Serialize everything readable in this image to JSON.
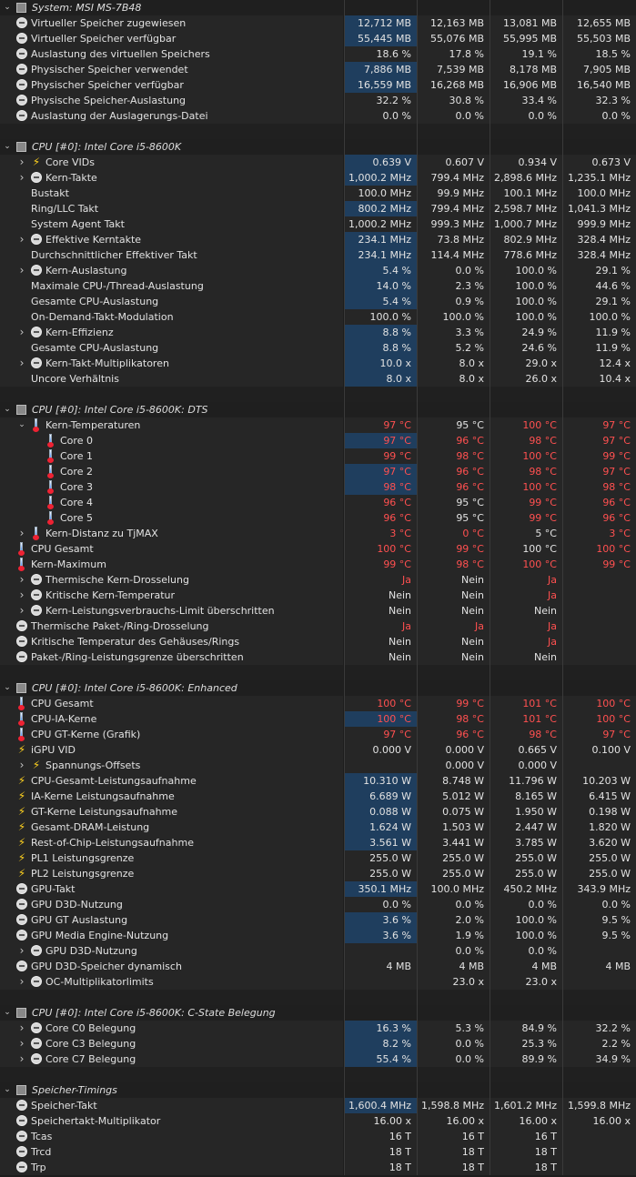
{
  "sections": [
    {
      "title": "System: MSI MS-7B48",
      "rows": [
        {
          "label": "Virtueller Speicher zugewiesen",
          "icon": "sensor",
          "vals": [
            "12,712 MB",
            "12,163 MB",
            "13,081 MB",
            "12,655 MB"
          ],
          "hl": true
        },
        {
          "label": "Virtueller Speicher verfügbar",
          "icon": "sensor",
          "vals": [
            "55,445 MB",
            "55,076 MB",
            "55,995 MB",
            "55,503 MB"
          ],
          "hl": true
        },
        {
          "label": "Auslastung des virtuellen Speichers",
          "icon": "sensor",
          "vals": [
            "18.6 %",
            "17.8 %",
            "19.1 %",
            "18.5 %"
          ]
        },
        {
          "label": "Physischer Speicher verwendet",
          "icon": "sensor",
          "vals": [
            "7,886 MB",
            "7,539 MB",
            "8,178 MB",
            "7,905 MB"
          ],
          "hl": true
        },
        {
          "label": "Physischer Speicher verfügbar",
          "icon": "sensor",
          "vals": [
            "16,559 MB",
            "16,268 MB",
            "16,906 MB",
            "16,540 MB"
          ],
          "hl": true
        },
        {
          "label": "Physische Speicher-Auslastung",
          "icon": "sensor",
          "vals": [
            "32.2 %",
            "30.8 %",
            "33.4 %",
            "32.3 %"
          ]
        },
        {
          "label": "Auslastung der Auslagerungs-Datei",
          "icon": "sensor",
          "vals": [
            "0.0 %",
            "0.0 %",
            "0.0 %",
            "0.0 %"
          ]
        }
      ]
    },
    {
      "title": "CPU [#0]: Intel Core i5-8600K",
      "rows": [
        {
          "label": "Core VIDs",
          "icon": "bolt",
          "expander": true,
          "vals": [
            "0.639 V",
            "0.607 V",
            "0.934 V",
            "0.673 V"
          ],
          "hl": true
        },
        {
          "label": "Kern-Takte",
          "icon": "sensor",
          "expander": true,
          "vals": [
            "1,000.2 MHz",
            "799.4 MHz",
            "2,898.6 MHz",
            "1,235.1 MHz"
          ],
          "hl": true
        },
        {
          "label": "Bustakt",
          "icon": "",
          "vals": [
            "100.0 MHz",
            "99.9 MHz",
            "100.1 MHz",
            "100.0 MHz"
          ]
        },
        {
          "label": "Ring/LLC Takt",
          "icon": "",
          "vals": [
            "800.2 MHz",
            "799.4 MHz",
            "2,598.7 MHz",
            "1,041.3 MHz"
          ],
          "hl": true
        },
        {
          "label": "System Agent Takt",
          "icon": "",
          "vals": [
            "1,000.2 MHz",
            "999.3 MHz",
            "1,000.7 MHz",
            "999.9 MHz"
          ]
        },
        {
          "label": "Effektive Kerntakte",
          "icon": "sensor",
          "expander": true,
          "vals": [
            "234.1 MHz",
            "73.8 MHz",
            "802.9 MHz",
            "328.4 MHz"
          ],
          "hl": true
        },
        {
          "label": "Durchschnittlicher Effektiver Takt",
          "icon": "",
          "vals": [
            "234.1 MHz",
            "114.4 MHz",
            "778.6 MHz",
            "328.4 MHz"
          ],
          "hl": true
        },
        {
          "label": "Kern-Auslastung",
          "icon": "sensor",
          "expander": true,
          "vals": [
            "5.4 %",
            "0.0 %",
            "100.0 %",
            "29.1 %"
          ],
          "hl": true
        },
        {
          "label": "Maximale CPU-/Thread-Auslastung",
          "icon": "",
          "vals": [
            "14.0 %",
            "2.3 %",
            "100.0 %",
            "44.6 %"
          ],
          "hl": true
        },
        {
          "label": "Gesamte CPU-Auslastung",
          "icon": "",
          "vals": [
            "5.4 %",
            "0.9 %",
            "100.0 %",
            "29.1 %"
          ],
          "hl": true
        },
        {
          "label": "On-Demand-Takt-Modulation",
          "icon": "",
          "vals": [
            "100.0 %",
            "100.0 %",
            "100.0 %",
            "100.0 %"
          ]
        },
        {
          "label": "Kern-Effizienz",
          "icon": "sensor",
          "expander": true,
          "vals": [
            "8.8 %",
            "3.3 %",
            "24.9 %",
            "11.9 %"
          ],
          "hl": true
        },
        {
          "label": "Gesamte CPU-Auslastung",
          "icon": "",
          "vals": [
            "8.8 %",
            "5.2 %",
            "24.6 %",
            "11.9 %"
          ],
          "hl": true
        },
        {
          "label": "Kern-Takt-Multiplikatoren",
          "icon": "sensor",
          "expander": true,
          "vals": [
            "10.0 x",
            "8.0 x",
            "29.0 x",
            "12.4 x"
          ],
          "hl": true
        },
        {
          "label": "Uncore Verhältnis",
          "icon": "",
          "vals": [
            "8.0 x",
            "8.0 x",
            "26.0 x",
            "10.4 x"
          ],
          "hl": true
        }
      ]
    },
    {
      "title": "CPU [#0]: Intel Core i5-8600K: DTS",
      "rows": [
        {
          "label": "Kern-Temperaturen",
          "icon": "thermo",
          "expander": true,
          "open": true,
          "vals": [
            "97 °C",
            "95 °C",
            "100 °C",
            "97 °C"
          ],
          "hot": [
            1,
            0,
            1,
            1
          ]
        },
        {
          "label": "Core 0",
          "icon": "thermo",
          "indent": 2,
          "vals": [
            "97 °C",
            "96 °C",
            "98 °C",
            "97 °C"
          ],
          "hot": [
            1,
            1,
            1,
            1
          ],
          "hl": true
        },
        {
          "label": "Core 1",
          "icon": "thermo",
          "indent": 2,
          "vals": [
            "99 °C",
            "98 °C",
            "100 °C",
            "99 °C"
          ],
          "hot": [
            1,
            1,
            1,
            1
          ]
        },
        {
          "label": "Core 2",
          "icon": "thermo",
          "indent": 2,
          "vals": [
            "97 °C",
            "96 °C",
            "98 °C",
            "97 °C"
          ],
          "hot": [
            1,
            1,
            1,
            1
          ],
          "hl": true
        },
        {
          "label": "Core 3",
          "icon": "thermo",
          "indent": 2,
          "vals": [
            "98 °C",
            "96 °C",
            "100 °C",
            "98 °C"
          ],
          "hot": [
            1,
            1,
            1,
            1
          ],
          "hl": true
        },
        {
          "label": "Core 4",
          "icon": "thermo",
          "indent": 2,
          "vals": [
            "96 °C",
            "95 °C",
            "99 °C",
            "96 °C"
          ],
          "hot": [
            1,
            0,
            1,
            1
          ]
        },
        {
          "label": "Core 5",
          "icon": "thermo",
          "indent": 2,
          "vals": [
            "96 °C",
            "95 °C",
            "99 °C",
            "96 °C"
          ],
          "hot": [
            1,
            0,
            1,
            1
          ]
        },
        {
          "label": "Kern-Distanz zu TjMAX",
          "icon": "thermo",
          "expander": true,
          "vals": [
            "3 °C",
            "0 °C",
            "5 °C",
            "3 °C"
          ],
          "hot": [
            1,
            1,
            0,
            1
          ]
        },
        {
          "label": "CPU Gesamt",
          "icon": "thermo",
          "vals": [
            "100 °C",
            "99 °C",
            "100 °C",
            "100 °C"
          ],
          "hot": [
            1,
            1,
            0,
            1
          ]
        },
        {
          "label": "Kern-Maximum",
          "icon": "thermo",
          "vals": [
            "99 °C",
            "98 °C",
            "100 °C",
            "99 °C"
          ],
          "hot": [
            1,
            1,
            1,
            1
          ]
        },
        {
          "label": "Thermische Kern-Drosselung",
          "icon": "sensor",
          "expander": true,
          "vals": [
            "Ja",
            "Nein",
            "Ja",
            ""
          ],
          "hot": [
            1,
            0,
            1,
            0
          ]
        },
        {
          "label": "Kritische Kern-Temperatur",
          "icon": "sensor",
          "expander": true,
          "vals": [
            "Nein",
            "Nein",
            "Ja",
            ""
          ],
          "hot": [
            0,
            0,
            1,
            0
          ]
        },
        {
          "label": "Kern-Leistungsverbrauchs-Limit überschritten",
          "icon": "sensor",
          "expander": true,
          "vals": [
            "Nein",
            "Nein",
            "Nein",
            ""
          ]
        },
        {
          "label": "Thermische Paket-/Ring-Drosselung",
          "icon": "sensor",
          "vals": [
            "Ja",
            "Ja",
            "Ja",
            ""
          ],
          "hot": [
            1,
            1,
            1,
            0
          ]
        },
        {
          "label": "Kritische Temperatur des Gehäuses/Rings",
          "icon": "sensor",
          "vals": [
            "Nein",
            "Nein",
            "Ja",
            ""
          ],
          "hot": [
            0,
            0,
            1,
            0
          ]
        },
        {
          "label": "Paket-/Ring-Leistungsgrenze überschritten",
          "icon": "sensor",
          "vals": [
            "Nein",
            "Nein",
            "Nein",
            ""
          ]
        }
      ]
    },
    {
      "title": "CPU [#0]: Intel Core i5-8600K: Enhanced",
      "rows": [
        {
          "label": "CPU Gesamt",
          "icon": "thermo",
          "vals": [
            "100 °C",
            "99 °C",
            "101 °C",
            "100 °C"
          ],
          "hot": [
            1,
            1,
            1,
            1
          ]
        },
        {
          "label": "CPU-IA-Kerne",
          "icon": "thermo",
          "vals": [
            "100 °C",
            "98 °C",
            "101 °C",
            "100 °C"
          ],
          "hot": [
            1,
            1,
            1,
            1
          ],
          "hl": true
        },
        {
          "label": "CPU GT-Kerne (Grafik)",
          "icon": "thermo",
          "vals": [
            "97 °C",
            "96 °C",
            "98 °C",
            "97 °C"
          ],
          "hot": [
            1,
            1,
            1,
            1
          ]
        },
        {
          "label": "iGPU VID",
          "icon": "bolt",
          "vals": [
            "0.000 V",
            "0.000 V",
            "0.665 V",
            "0.100 V"
          ]
        },
        {
          "label": "Spannungs-Offsets",
          "icon": "bolt",
          "expander": true,
          "vals": [
            "",
            "0.000 V",
            "0.000 V",
            ""
          ]
        },
        {
          "label": "CPU-Gesamt-Leistungsaufnahme",
          "icon": "bolt",
          "vals": [
            "10.310 W",
            "8.748 W",
            "11.796 W",
            "10.203 W"
          ],
          "hl": true
        },
        {
          "label": "IA-Kerne Leistungsaufnahme",
          "icon": "bolt",
          "vals": [
            "6.689 W",
            "5.012 W",
            "8.165 W",
            "6.415 W"
          ],
          "hl": true
        },
        {
          "label": "GT-Kerne Leistungsaufnahme",
          "icon": "bolt",
          "vals": [
            "0.088 W",
            "0.075 W",
            "1.950 W",
            "0.198 W"
          ],
          "hl": true
        },
        {
          "label": "Gesamt-DRAM-Leistung",
          "icon": "bolt",
          "vals": [
            "1.624 W",
            "1.503 W",
            "2.447 W",
            "1.820 W"
          ],
          "hl": true
        },
        {
          "label": "Rest-of-Chip-Leistungsaufnahme",
          "icon": "bolt",
          "vals": [
            "3.561 W",
            "3.441 W",
            "3.785 W",
            "3.620 W"
          ],
          "hl": true
        },
        {
          "label": "PL1 Leistungsgrenze",
          "icon": "bolt",
          "vals": [
            "255.0 W",
            "255.0 W",
            "255.0 W",
            "255.0 W"
          ]
        },
        {
          "label": "PL2 Leistungsgrenze",
          "icon": "bolt",
          "vals": [
            "255.0 W",
            "255.0 W",
            "255.0 W",
            "255.0 W"
          ]
        },
        {
          "label": "GPU-Takt",
          "icon": "sensor",
          "vals": [
            "350.1 MHz",
            "100.0 MHz",
            "450.2 MHz",
            "343.9 MHz"
          ],
          "hl": true
        },
        {
          "label": "GPU D3D-Nutzung",
          "icon": "sensor",
          "vals": [
            "0.0 %",
            "0.0 %",
            "0.0 %",
            "0.0 %"
          ]
        },
        {
          "label": "GPU GT Auslastung",
          "icon": "sensor",
          "vals": [
            "3.6 %",
            "2.0 %",
            "100.0 %",
            "9.5 %"
          ],
          "hl": true
        },
        {
          "label": "GPU Media Engine-Nutzung",
          "icon": "sensor",
          "vals": [
            "3.6 %",
            "1.9 %",
            "100.0 %",
            "9.5 %"
          ],
          "hl": true
        },
        {
          "label": "GPU D3D-Nutzung",
          "icon": "sensor",
          "expander": true,
          "vals": [
            "",
            "0.0 %",
            "0.0 %",
            ""
          ]
        },
        {
          "label": "GPU D3D-Speicher dynamisch",
          "icon": "sensor",
          "vals": [
            "4 MB",
            "4 MB",
            "4 MB",
            "4 MB"
          ]
        },
        {
          "label": "OC-Multiplikatorlimits",
          "icon": "sensor",
          "expander": true,
          "vals": [
            "",
            "23.0 x",
            "23.0 x",
            ""
          ]
        }
      ]
    },
    {
      "title": "CPU [#0]: Intel Core i5-8600K: C-State Belegung",
      "rows": [
        {
          "label": "Core C0 Belegung",
          "icon": "sensor",
          "expander": true,
          "vals": [
            "16.3 %",
            "5.3 %",
            "84.9 %",
            "32.2 %"
          ],
          "hl": true
        },
        {
          "label": "Core C3 Belegung",
          "icon": "sensor",
          "expander": true,
          "vals": [
            "8.2 %",
            "0.0 %",
            "25.3 %",
            "2.2 %"
          ],
          "hl": true
        },
        {
          "label": "Core C7 Belegung",
          "icon": "sensor",
          "expander": true,
          "vals": [
            "55.4 %",
            "0.0 %",
            "89.9 %",
            "34.9 %"
          ],
          "hl": true
        }
      ]
    },
    {
      "title": "Speicher-Timings",
      "rows": [
        {
          "label": "Speicher-Takt",
          "icon": "sensor",
          "vals": [
            "1,600.4 MHz",
            "1,598.8 MHz",
            "1,601.2 MHz",
            "1,599.8 MHz"
          ],
          "hl": true
        },
        {
          "label": "Speichertakt-Multiplikator",
          "icon": "sensor",
          "vals": [
            "16.00 x",
            "16.00 x",
            "16.00 x",
            "16.00 x"
          ]
        },
        {
          "label": "Tcas",
          "icon": "sensor",
          "vals": [
            "16 T",
            "16 T",
            "16 T",
            ""
          ]
        },
        {
          "label": "Trcd",
          "icon": "sensor",
          "vals": [
            "18 T",
            "18 T",
            "18 T",
            ""
          ]
        },
        {
          "label": "Trp",
          "icon": "sensor",
          "vals": [
            "18 T",
            "18 T",
            "18 T",
            ""
          ]
        }
      ]
    }
  ]
}
